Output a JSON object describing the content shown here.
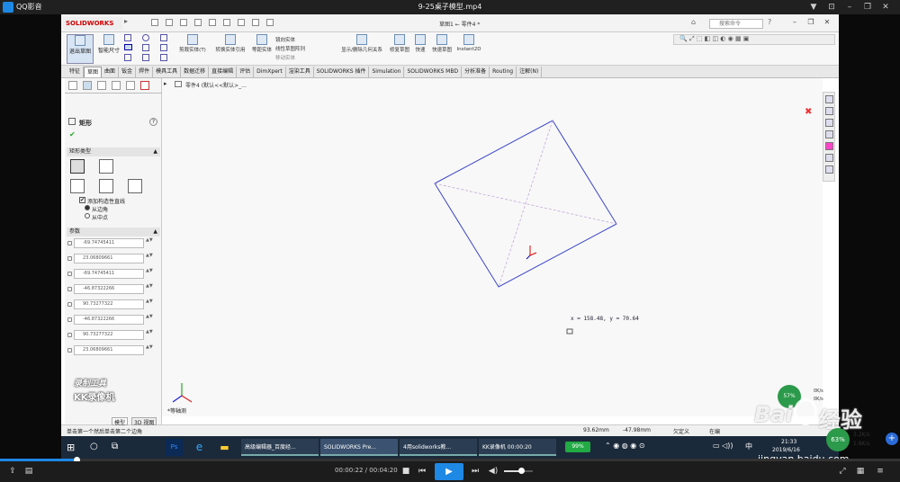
{
  "player": {
    "app_name": "QQ影音",
    "file_title": "9-25桌子模型.mp4",
    "current_time": "00:00:22",
    "total_time": "00:04:20",
    "time_sep": " / ",
    "progress_fraction": 0.085,
    "volume_fraction": 0.6
  },
  "sw": {
    "logo": "SOLIDWORKS",
    "doc_title": "草图1 ← 零件4 *",
    "search_placeholder": "搜索命令",
    "ribbon": {
      "exit_sketch": "退出草图",
      "smart_dim": "智能尺寸",
      "trim": "剪裁实体(T)",
      "convert": "转换实体引用",
      "offset": "等距实体",
      "mirror": "镜向实体",
      "linear_pattern": "线性草图阵列",
      "move": "移动实体",
      "show_relations": "显示/删除几何关系",
      "repair": "修复草图",
      "quick_snap": "快速",
      "rapid_sketch": "快速草图",
      "instant2d": "Instant2D"
    },
    "tabs": [
      "特征",
      "草图",
      "曲面",
      "钣金",
      "焊件",
      "模具工具",
      "数据迁移",
      "直接编辑",
      "评估",
      "DimXpert",
      "渲染工具",
      "SOLIDWORKS 插件",
      "Simulation",
      "SOLIDWORKS MBD",
      "分析准备",
      "Routing",
      "注解(N)"
    ],
    "active_tab": "草图",
    "breadcrumb": "零件4 (默认<<默认>_...",
    "pm": {
      "title": "矩形",
      "section_type": "矩形类型",
      "add_construction": "添加构造性直线",
      "from_corner": "从边角",
      "from_mid": "从中点",
      "section_params": "参数",
      "params": [
        "-69.74745411",
        "23.06809661",
        "-69.74745411",
        "-46.87322266",
        "90.73277322",
        "-46.87322266",
        "90.73277322",
        "23.06809661"
      ]
    },
    "coord_readout": "x = 158.48,  y = 70.64",
    "view_label": "*等轴测",
    "bottom_tabs": [
      "模型",
      "3D 视图"
    ],
    "status_hint": "单击第一个然后单击第二个边角",
    "status_x": "93.62mm",
    "status_y": "-47.98mm",
    "status_def": "欠定义",
    "status_edit": "在编",
    "watermark1": "录制工具",
    "watermark2": "KK录像机"
  },
  "taskbar": {
    "items": [
      "高级编辑器_百度经...",
      "SOLIDWORKS Pre...",
      "4用solidworks教...",
      "KK录像机 00:00:20"
    ],
    "battery": "99%",
    "lang": "中",
    "time": "21:33",
    "date": "2019/6/16"
  },
  "overlay": {
    "speed_percent": "63%",
    "up_speed": "3.2K/s",
    "down_speed": "1.8K/s",
    "mini_percent": "57%",
    "mini_up": "0K/s",
    "mini_down": "0K/s",
    "baidu_brand": "Bai",
    "baidu_jingyan": "经验",
    "baidu_url": "jingyan.baidu.com"
  }
}
